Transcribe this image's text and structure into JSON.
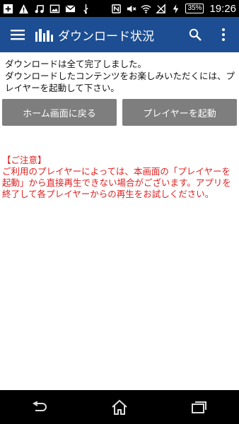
{
  "status_bar": {
    "icons_left": [
      "add-box-icon",
      "warning-icon",
      "music-icon",
      "image-icon",
      "gmail-icon",
      "usb-icon"
    ],
    "icons_right": [
      "nfc-icon",
      "mute-icon",
      "wifi-icon",
      "no-signal-icon",
      "charging-icon"
    ],
    "battery": "35%",
    "time": "19:26"
  },
  "app_bar": {
    "title": "ダウンロード状況",
    "color": "#1d4e93"
  },
  "main": {
    "message": "ダウンロードは全て完了しました。\nダウンロードしたコンテンツをお楽しみいただくには、プレイヤーを起動して下さい。",
    "home_button_label": "ホーム画面に戻る",
    "player_button_label": "プレイヤーを起動",
    "notice_title": "【ご注意】",
    "notice_body": "ご利用のプレイヤーによっては、本画面の「プレイヤーを起動」から直接再生できない場合がございます。アプリを終了して各プレイヤーからの再生をお試しください。",
    "notice_color": "#e02020"
  },
  "nav_bar": {
    "buttons": [
      "back-icon",
      "home-icon",
      "recent-apps-icon"
    ]
  }
}
